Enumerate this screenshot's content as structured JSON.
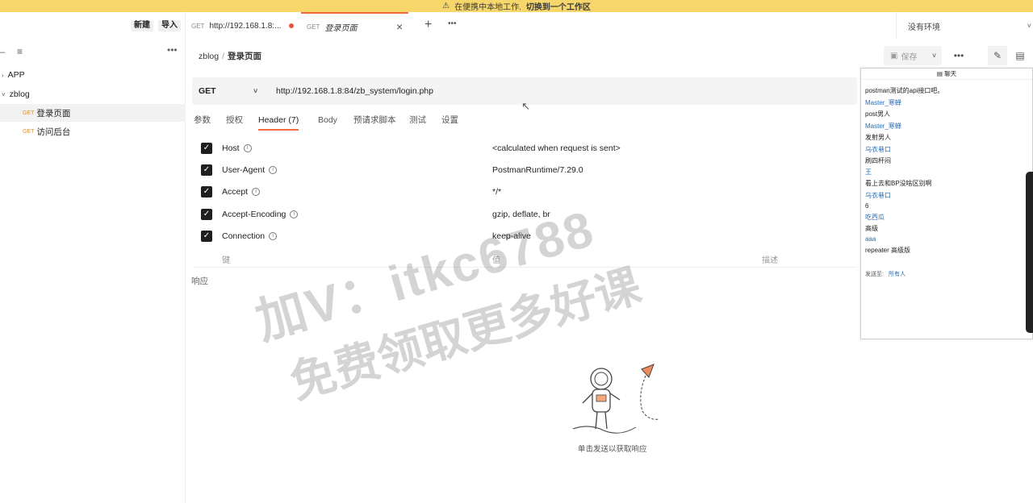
{
  "banner": {
    "text": "在便携中本地工作.",
    "link": "切换到一个工作区"
  },
  "sidebar": {
    "new_label": "新建",
    "import_label": "导入",
    "tree": [
      {
        "label": "APP",
        "type": "folder"
      },
      {
        "label": "zblog",
        "type": "folder"
      },
      {
        "method": "GET",
        "label": "登录页面",
        "type": "request",
        "active": true
      },
      {
        "method": "GET",
        "label": "访问后台",
        "type": "request"
      }
    ]
  },
  "tabs": [
    {
      "method": "GET",
      "label": "http://192.168.1.8:...",
      "unsaved": true
    },
    {
      "method": "GET",
      "label": "登录页面",
      "active": true
    }
  ],
  "environment": {
    "label": "没有环境"
  },
  "breadcrumb": {
    "parent": "zblog",
    "separator": "/",
    "current": "登录页面"
  },
  "toolbar": {
    "save_label": "保存"
  },
  "request": {
    "method": "GET",
    "url": "http://192.168.1.8:84/zb_system/login.php"
  },
  "request_tabs": [
    "参数",
    "授权",
    "Header (7)",
    "Body",
    "预请求脚本",
    "测试",
    "设置"
  ],
  "headers": [
    {
      "key": "Host",
      "value": "<calculated when request is sent>",
      "checked": true
    },
    {
      "key": "User-Agent",
      "value": "PostmanRuntime/7.29.0",
      "checked": true
    },
    {
      "key": "Accept",
      "value": "*/*",
      "checked": true
    },
    {
      "key": "Accept-Encoding",
      "value": "gzip, deflate, br",
      "checked": true
    },
    {
      "key": "Connection",
      "value": "keep-alive",
      "checked": true
    }
  ],
  "header_columns": {
    "key": "键",
    "value": "值",
    "description": "描述"
  },
  "response": {
    "label": "响应",
    "hint": "单击发送以获取响应"
  },
  "chat": {
    "title": "聊天",
    "messages": [
      {
        "text": "postman测试的api接口吧。",
        "kind": "text"
      },
      {
        "text": "Master_寒蝉",
        "kind": "name"
      },
      {
        "text": "post男人",
        "kind": "text"
      },
      {
        "text": "Master_寒蝉",
        "kind": "name"
      },
      {
        "text": "发射男人",
        "kind": "text"
      },
      {
        "text": "乌衣巷口",
        "kind": "name"
      },
      {
        "text": "刷四杆闷",
        "kind": "text"
      },
      {
        "text": "王",
        "kind": "name"
      },
      {
        "text": "看上去和BP没啥区别啊",
        "kind": "text"
      },
      {
        "text": "乌衣巷口",
        "kind": "name"
      },
      {
        "text": "6",
        "kind": "text"
      },
      {
        "text": "吃西瓜",
        "kind": "name"
      },
      {
        "text": "高级",
        "kind": "text"
      },
      {
        "text": "aaa",
        "kind": "name"
      },
      {
        "text": "repeater 高级版",
        "kind": "text"
      }
    ],
    "send_to_label": "发送至:",
    "send_to_value": "所有人"
  },
  "watermark": {
    "line1": "加V：itkc6788",
    "line2": "免费领取更多好课"
  },
  "colors": {
    "accent": "#f26b3a",
    "banner": "#f7d66c",
    "method_get": "#e09032",
    "chat_name": "#2b6cb0"
  }
}
